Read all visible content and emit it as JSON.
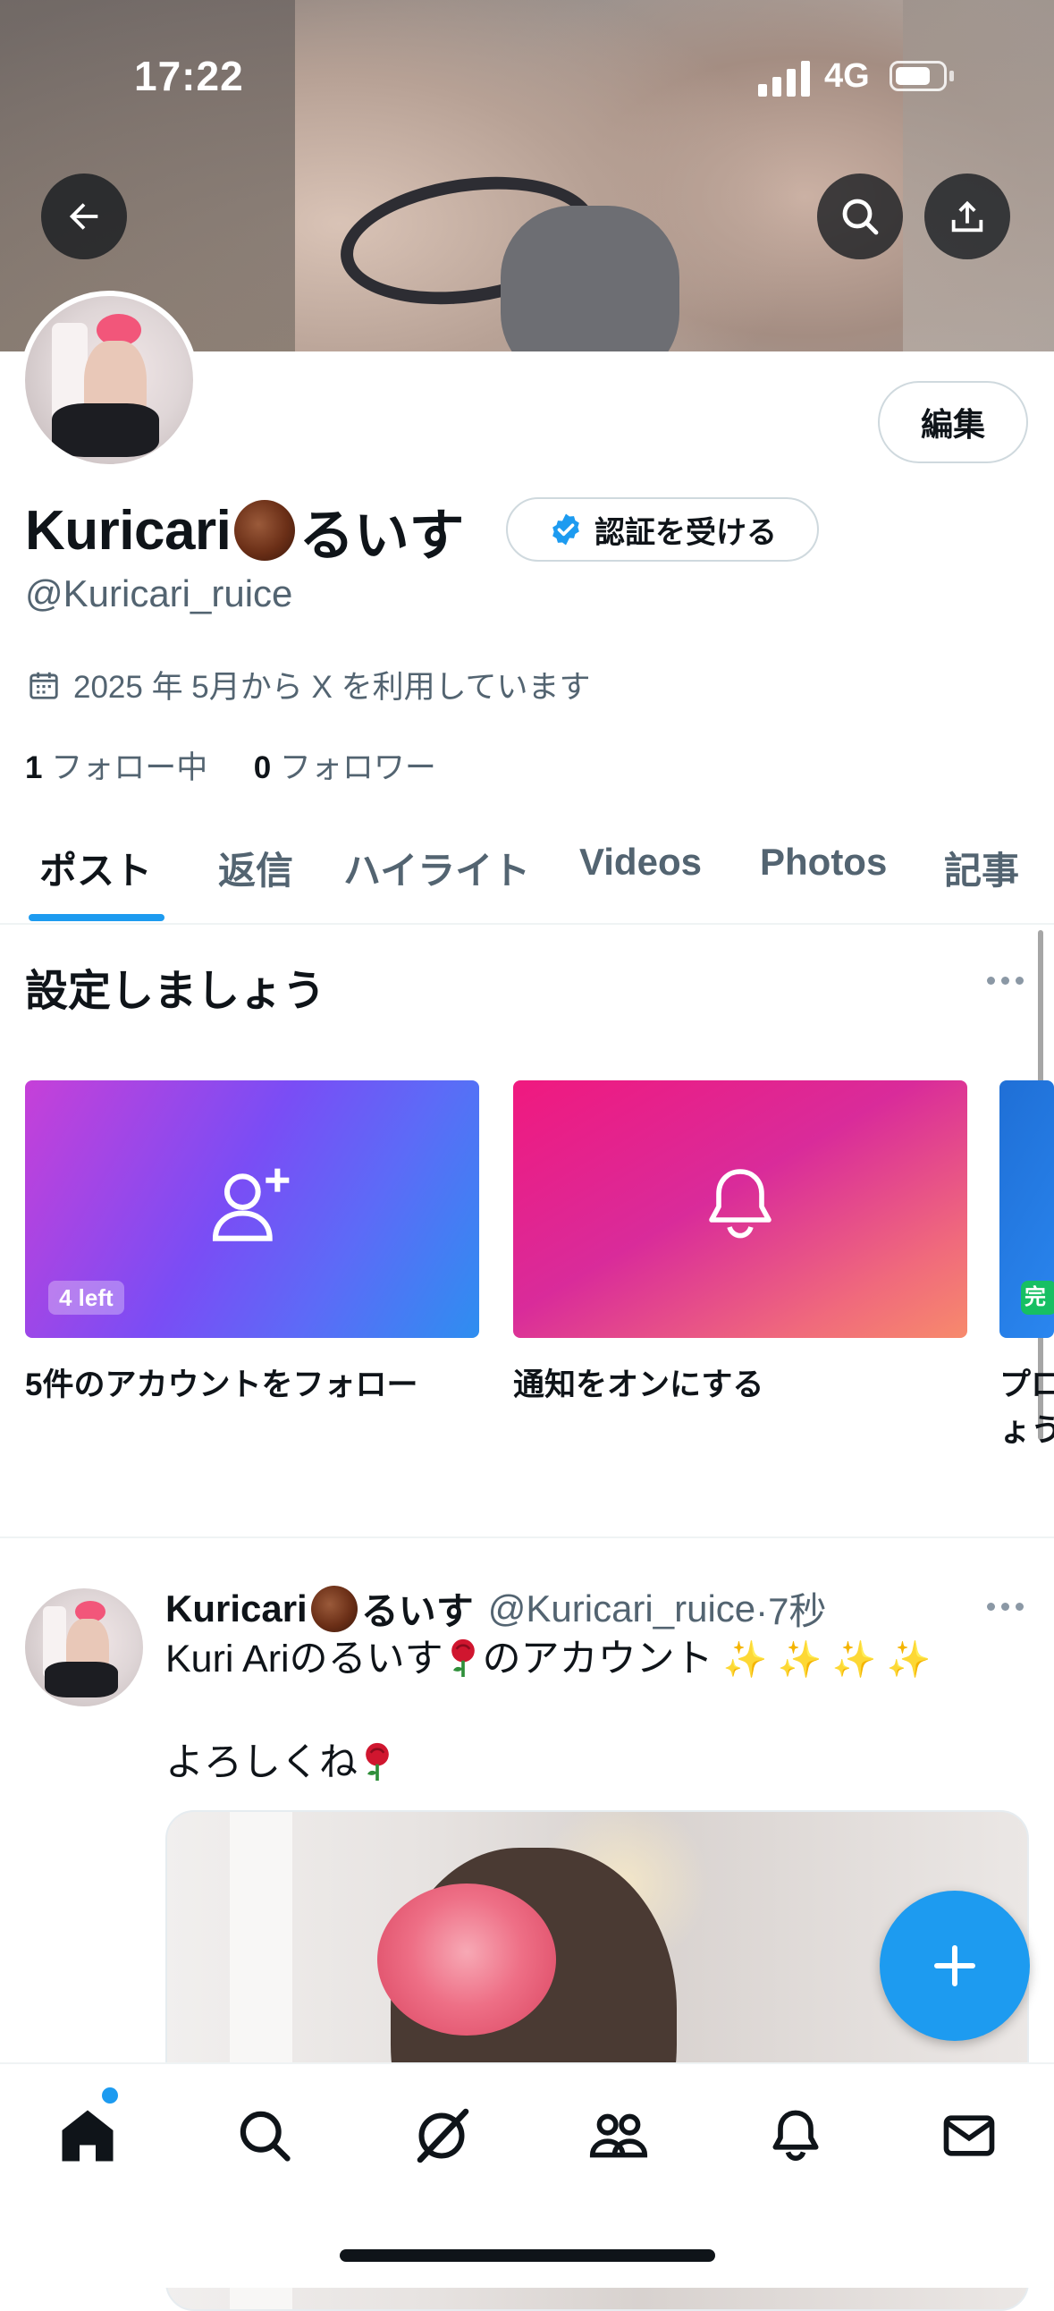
{
  "status_bar": {
    "time": "17:22",
    "network": "4G"
  },
  "profile": {
    "name": "Kuricari",
    "name_suffix": "るいす",
    "handle": "@Kuricari_ruice",
    "edit_label": "編集",
    "verify_label": "認証を受ける",
    "joined": "2025 年 5月から X を利用しています",
    "following_count": "1",
    "following_label": "フォロー中",
    "followers_count": "0",
    "followers_label": "フォロワー"
  },
  "tabs": [
    "ポスト",
    "返信",
    "ハイライト",
    "Videos",
    "Photos",
    "記事"
  ],
  "setup": {
    "title": "設定しましょう",
    "cards": [
      {
        "label": "5件のアカウントをフォロー",
        "badge": "4 left",
        "icon": "add-person-icon"
      },
      {
        "label": "通知をオンにする",
        "icon": "bell-icon"
      },
      {
        "label": "プロ",
        "label2": "ょう",
        "badge": "完"
      }
    ]
  },
  "post": {
    "author": "Kuricari",
    "author_suffix": "るいす",
    "handle": "@Kuricari_ruice",
    "time": "·7秒",
    "line1_a": "Kuri Ariのるいす",
    "line1_b": "のアカウント",
    "line2": "よろしくね"
  },
  "colors": {
    "accent": "#1d9bf0",
    "text": "#0f1419",
    "secondary": "#536471"
  }
}
